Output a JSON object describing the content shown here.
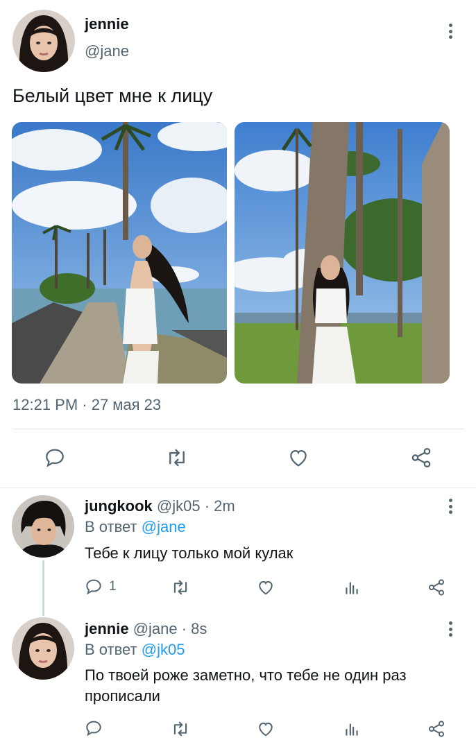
{
  "tweet": {
    "author_name": "jennie",
    "author_handle": "@jane",
    "text": "Белый цвет мне к лицу",
    "timestamp": "12:21 PM · 27 мая 23",
    "photos": [
      "photo-1",
      "photo-2"
    ]
  },
  "replies": [
    {
      "author_name": "jungkook",
      "meta": "@jk05 · 2m",
      "reply_to_prefix": "В ответ",
      "reply_to_handle": "@jane",
      "text": "Тебе к лицу только мой кулак",
      "reply_count": "1"
    },
    {
      "author_name": "jennie",
      "meta": "@jane · 8s",
      "reply_to_prefix": "В ответ",
      "reply_to_handle": "@jk05",
      "text": "По твоей роже заметно, что тебе не один раз прописали",
      "reply_count": ""
    }
  ],
  "icons": [
    "reply-icon",
    "retweet-icon",
    "like-icon",
    "views-icon",
    "share-icon",
    "more-icon"
  ],
  "colors": {
    "link": "#1d9bf0",
    "muted": "#536471",
    "text": "#0f1419"
  }
}
